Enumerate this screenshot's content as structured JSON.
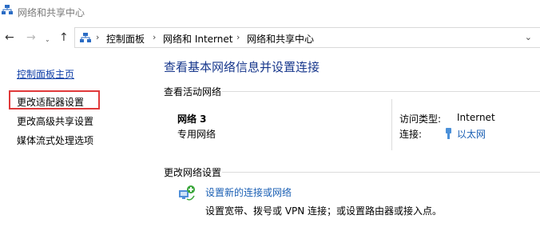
{
  "window": {
    "title": "网络和共享中心"
  },
  "nav": {
    "back": "←",
    "forward": "→",
    "dropdown": "⌄",
    "up": "↑"
  },
  "address": {
    "crumbs": [
      "控制面板",
      "网络和 Internet",
      "网络和共享中心"
    ],
    "separator": "›",
    "dropdown": "⌄"
  },
  "sidebar": {
    "home": "控制面板主页",
    "items": [
      "更改适配器设置",
      "更改高级共享设置",
      "媒体流式处理选项"
    ]
  },
  "main": {
    "title": "查看基本网络信息并设置连接",
    "active_header": "查看活动网络",
    "network": {
      "name": "网络 3",
      "type": "专用网络",
      "access_label": "访问类型:",
      "access_value": "Internet",
      "conn_label": "连接:",
      "conn_value": "以太网"
    },
    "change_header": "更改网络设置",
    "setup_link": "设置新的连接或网络",
    "setup_desc": "设置宽带、拨号或 VPN 连接；或设置路由器或接入点。"
  },
  "colors": {
    "link": "#1a5fb4",
    "title": "#17378c",
    "highlight": "#e0393a"
  },
  "icons": [
    "network-center-icon",
    "back-arrow-icon",
    "forward-arrow-icon",
    "up-arrow-icon",
    "ethernet-icon",
    "new-connection-icon"
  ]
}
